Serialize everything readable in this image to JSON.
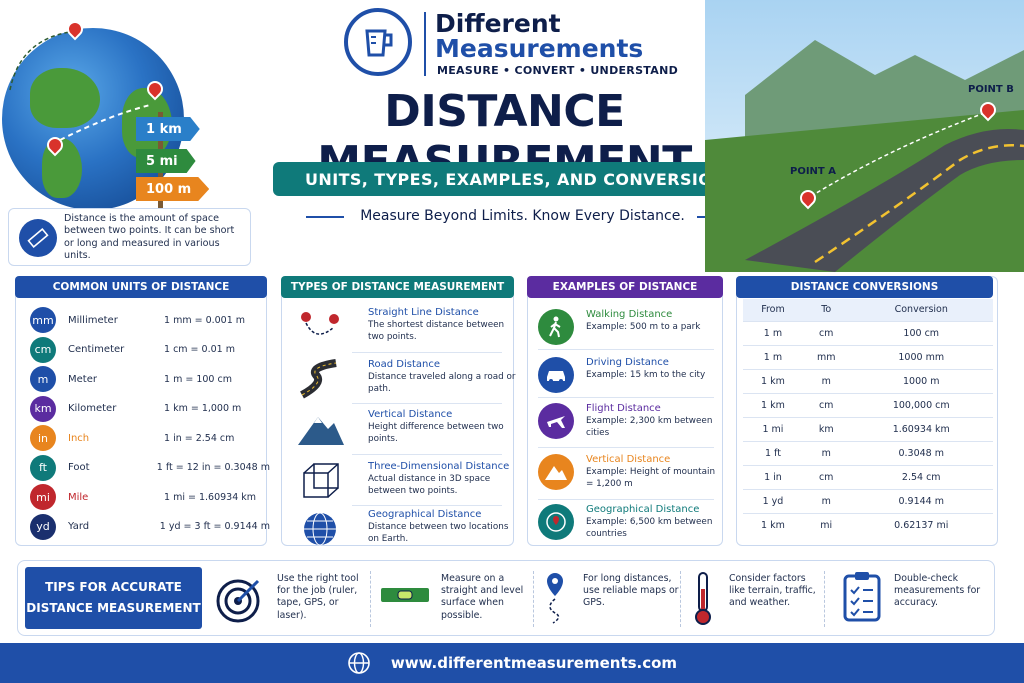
{
  "header": {
    "brand_line1": "Different",
    "brand_line2": "Measurements",
    "brand_tagline": "MEASURE • CONVERT • UNDERSTAND",
    "title": "DISTANCE MEASUREMENT",
    "subtitle": "UNITS, TYPES, EXAMPLES, AND CONVERSIONS",
    "tagline": "Measure Beyond Limits. Know Every Distance."
  },
  "signs": [
    "1 km",
    "5 mi",
    "100 m"
  ],
  "landscape": {
    "point_a": "POINT A",
    "point_b": "POINT B"
  },
  "definition": "Distance is the amount of space between two points. It can be short or long and measured in various units.",
  "units": {
    "heading": "COMMON UNITS OF DISTANCE",
    "items": [
      {
        "abbr": "mm",
        "name": "Millimeter",
        "eq": "1 mm = 0.001 m",
        "color": "#1f4fa8"
      },
      {
        "abbr": "cm",
        "name": "Centimeter",
        "eq": "1 cm = 0.01 m",
        "color": "#0f7a7a"
      },
      {
        "abbr": "m",
        "name": "Meter",
        "eq": "1 m = 100 cm",
        "color": "#1f4fa8"
      },
      {
        "abbr": "km",
        "name": "Kilometer",
        "eq": "1 km = 1,000 m",
        "color": "#5b2ca0"
      },
      {
        "abbr": "in",
        "name": "Inch",
        "eq": "1 in = 2.54 cm",
        "color": "#e8851e"
      },
      {
        "abbr": "ft",
        "name": "Foot",
        "eq": "1 ft = 12 in = 0.3048 m",
        "color": "#0f7a7a"
      },
      {
        "abbr": "mi",
        "name": "Mile",
        "eq": "1 mi = 1.60934 km",
        "color": "#c0272d"
      },
      {
        "abbr": "yd",
        "name": "Yard",
        "eq": "1 yd = 3 ft = 0.9144 m",
        "color": "#1a2f6e"
      }
    ]
  },
  "types": {
    "heading": "TYPES OF DISTANCE MEASUREMENT",
    "items": [
      {
        "title": "Straight Line Distance",
        "desc": "The shortest distance between two points."
      },
      {
        "title": "Road Distance",
        "desc": "Distance traveled along a road or path."
      },
      {
        "title": "Vertical Distance",
        "desc": "Height difference between two points."
      },
      {
        "title": "Three-Dimensional Distance",
        "desc": "Actual distance in 3D space between two points."
      },
      {
        "title": "Geographical Distance",
        "desc": "Distance between two locations on Earth."
      }
    ]
  },
  "examples": {
    "heading": "EXAMPLES OF DISTANCE",
    "items": [
      {
        "title": "Walking Distance",
        "desc": "Example: 500 m to a park",
        "color": "#2e8b3e"
      },
      {
        "title": "Driving Distance",
        "desc": "Example: 15 km to the city",
        "color": "#1f4fa8"
      },
      {
        "title": "Flight Distance",
        "desc": "Example: 2,300 km between cities",
        "color": "#5b2ca0"
      },
      {
        "title": "Vertical Distance",
        "desc": "Example: Height of mountain = 1,200 m",
        "color": "#e8851e"
      },
      {
        "title": "Geographical Distance",
        "desc": "Example: 6,500 km between countries",
        "color": "#0f7a7a"
      }
    ]
  },
  "conversions": {
    "heading": "DISTANCE CONVERSIONS",
    "columns": [
      "From",
      "To",
      "Conversion"
    ],
    "rows": [
      [
        "1 m",
        "cm",
        "100 cm"
      ],
      [
        "1 m",
        "mm",
        "1000 mm"
      ],
      [
        "1 km",
        "m",
        "1000 m"
      ],
      [
        "1 km",
        "cm",
        "100,000 cm"
      ],
      [
        "1 mi",
        "km",
        "1.60934 km"
      ],
      [
        "1 ft",
        "m",
        "0.3048 m"
      ],
      [
        "1 in",
        "cm",
        "2.54 cm"
      ],
      [
        "1 yd",
        "m",
        "0.9144 m"
      ],
      [
        "1 km",
        "mi",
        "0.62137 mi"
      ]
    ]
  },
  "tips": {
    "heading_line1": "TIPS FOR ACCURATE",
    "heading_line2": "DISTANCE MEASUREMENT",
    "items": [
      "Use the right tool for the job (ruler, tape, GPS, or laser).",
      "Measure on a straight and level surface when possible.",
      "For long distances, use reliable maps or GPS.",
      "Consider factors like terrain, traffic, and weather.",
      "Double-check measurements for accuracy."
    ]
  },
  "footer": {
    "url": "www.differentmeasurements.com"
  },
  "colors": {
    "navy": "#0e1e4a",
    "blue": "#1f4fa8",
    "teal": "#0f7a7a",
    "green": "#2e8b3e",
    "purple": "#5b2ca0",
    "orange": "#e8851e",
    "red": "#c0272d"
  }
}
